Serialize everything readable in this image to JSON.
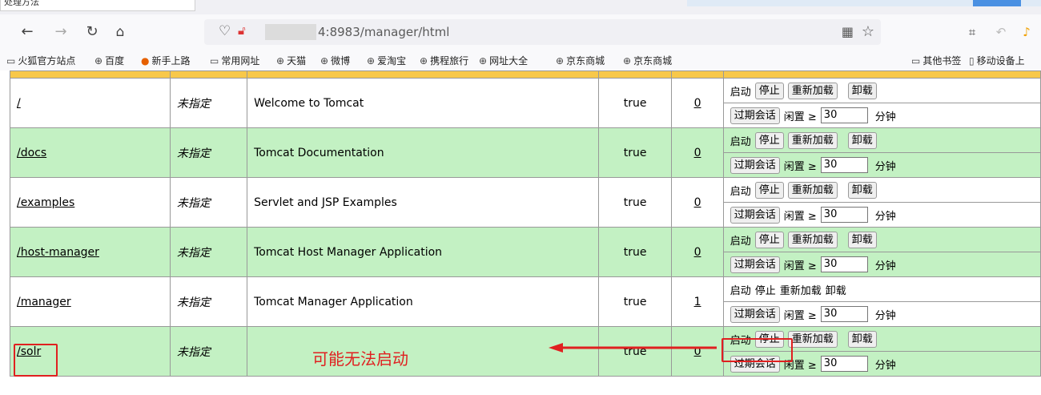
{
  "top_popup_text": "处理方法",
  "nav": {
    "back_icon": "back-arrow-icon",
    "url": "4:8983/manager/html"
  },
  "bookmarks": [
    {
      "label": "火狐官方站点",
      "icon": "folder-icon"
    },
    {
      "label": "百度",
      "icon": "globe-icon"
    },
    {
      "label": "新手上路",
      "icon": "firefox-icon"
    },
    {
      "label": "常用网址",
      "icon": "folder-icon"
    },
    {
      "label": "天猫",
      "icon": "globe-icon"
    },
    {
      "label": "微博",
      "icon": "globe-icon"
    },
    {
      "label": "爱淘宝",
      "icon": "globe-icon"
    },
    {
      "label": "携程旅行",
      "icon": "globe-icon"
    },
    {
      "label": "网址大全",
      "icon": "globe-icon"
    },
    {
      "label": "京东商城",
      "icon": "globe-icon"
    },
    {
      "label": "京东商城",
      "icon": "globe-icon"
    }
  ],
  "bookmarks_right": [
    {
      "label": "其他书签",
      "icon": "folder-icon"
    },
    {
      "label": "移动设备上",
      "icon": "mobile-icon"
    }
  ],
  "apps": [
    {
      "path": "/",
      "version": "未指定",
      "name": "Welcome to Tomcat",
      "running": "true",
      "sessions": "0",
      "row": "white",
      "cmds": "buttons"
    },
    {
      "path": "/docs",
      "version": "未指定",
      "name": "Tomcat Documentation",
      "running": "true",
      "sessions": "0",
      "row": "green",
      "cmds": "buttons"
    },
    {
      "path": "/examples",
      "version": "未指定",
      "name": "Servlet and JSP Examples",
      "running": "true",
      "sessions": "0",
      "row": "white",
      "cmds": "buttons"
    },
    {
      "path": "/host-manager",
      "version": "未指定",
      "name": "Tomcat Host Manager Application",
      "running": "true",
      "sessions": "0",
      "row": "green",
      "cmds": "buttons"
    },
    {
      "path": "/manager",
      "version": "未指定",
      "name": "Tomcat Manager Application",
      "running": "true",
      "sessions": "1",
      "row": "white",
      "cmds": "plain"
    },
    {
      "path": "/solr",
      "version": "未指定",
      "name": "",
      "running": "true",
      "sessions": "0",
      "row": "green",
      "cmds": "buttons"
    }
  ],
  "commands": {
    "start": "启动",
    "stop": "停止",
    "reload": "重新加载",
    "undeploy": "卸载",
    "expire": "过期会话",
    "idle": "闲置 ≥",
    "idle_value": "30",
    "minutes": "分钟"
  },
  "annotation": {
    "text": "可能无法启动",
    "color": "#e02020"
  }
}
